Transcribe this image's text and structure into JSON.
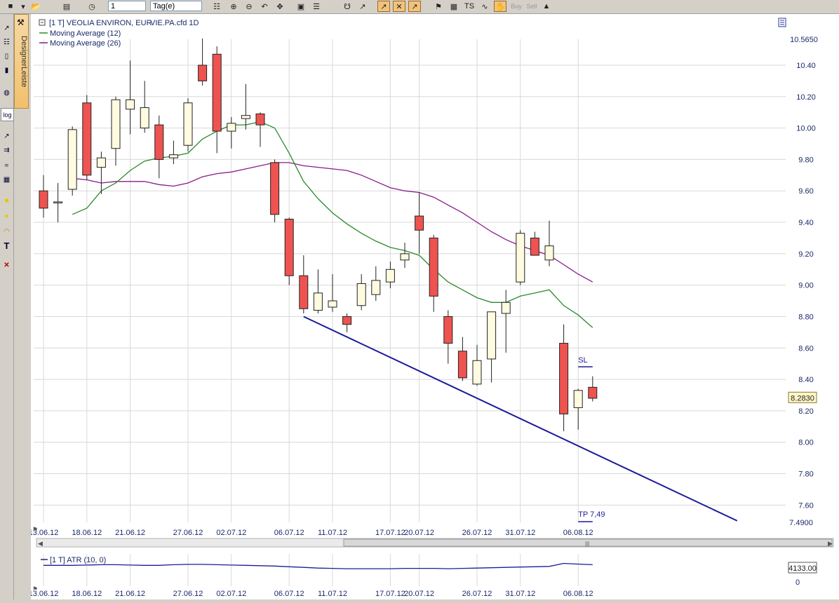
{
  "toolbar": {
    "period_value": "1",
    "timeframe_value": "Tag(e)",
    "buy_label": "Buy",
    "sell_label": "Sell"
  },
  "designer": {
    "label": "DesignerLeiste"
  },
  "left_tools": {
    "log_label": "log",
    "text_tool_label": "T"
  },
  "legend": {
    "instrument": "[1 T] VEOLIA ENVIRON, EUR",
    "symbol": "VIE.PA.cfd 1D",
    "ma12": "Moving Average  (12)",
    "ma26": "Moving Average  (26)"
  },
  "colors": {
    "up_candle": "#fffbe0",
    "down_candle": "#ef5350",
    "ma12": "#2b8a2b",
    "ma26": "#8b1a8b",
    "trendline": "#1c1c99",
    "grid": "#d8d8d8",
    "axis_text": "#1a2a6a"
  },
  "chart_data": [
    {
      "type": "candlestick",
      "ylim": [
        7.49,
        10.565
      ],
      "y_ticks": [
        "10.40",
        "10.20",
        "10.00",
        "9.80",
        "9.60",
        "9.40",
        "9.20",
        "9.00",
        "8.80",
        "8.60",
        "8.40",
        "8.20",
        "8.00",
        "7.80",
        "7.60"
      ],
      "y_top_label": "10.5650",
      "y_bottom_label": "7.4900",
      "x_labels": [
        "13.06.12",
        "18.06.12",
        "21.06.12",
        "27.06.12",
        "02.07.12",
        "06.07.12",
        "11.07.12",
        "17.07.12",
        "20.07.12",
        "26.07.12",
        "31.07.12",
        "06.08.12"
      ],
      "x_label_index": [
        0,
        3,
        6,
        10,
        13,
        17,
        20,
        24,
        26,
        30,
        33,
        37
      ],
      "current_price": "8.2830",
      "candles": [
        {
          "o": 9.6,
          "h": 9.7,
          "l": 9.43,
          "c": 9.49
        },
        {
          "o": 9.53,
          "h": 9.65,
          "l": 9.4,
          "c": 9.53
        },
        {
          "o": 9.61,
          "h": 10.01,
          "l": 9.57,
          "c": 9.99
        },
        {
          "o": 10.16,
          "h": 10.21,
          "l": 9.67,
          "c": 9.7
        },
        {
          "o": 9.75,
          "h": 9.85,
          "l": 9.58,
          "c": 9.81
        },
        {
          "o": 9.87,
          "h": 10.2,
          "l": 9.76,
          "c": 10.18
        },
        {
          "o": 10.12,
          "h": 10.43,
          "l": 9.96,
          "c": 10.18
        },
        {
          "o": 10.0,
          "h": 10.3,
          "l": 9.97,
          "c": 10.13
        },
        {
          "o": 10.02,
          "h": 10.08,
          "l": 9.68,
          "c": 9.8
        },
        {
          "o": 9.81,
          "h": 9.92,
          "l": 9.77,
          "c": 9.83
        },
        {
          "o": 9.89,
          "h": 10.19,
          "l": 9.85,
          "c": 10.16
        },
        {
          "o": 10.4,
          "h": 10.57,
          "l": 10.27,
          "c": 10.3
        },
        {
          "o": 10.47,
          "h": 10.52,
          "l": 9.84,
          "c": 9.98
        },
        {
          "o": 9.98,
          "h": 10.07,
          "l": 9.87,
          "c": 10.03
        },
        {
          "o": 10.06,
          "h": 10.28,
          "l": 9.99,
          "c": 10.08
        },
        {
          "o": 10.09,
          "h": 10.1,
          "l": 9.88,
          "c": 10.02
        },
        {
          "o": 9.78,
          "h": 9.8,
          "l": 9.4,
          "c": 9.45
        },
        {
          "o": 9.42,
          "h": 9.43,
          "l": 9.0,
          "c": 9.06
        },
        {
          "o": 9.06,
          "h": 9.19,
          "l": 8.82,
          "c": 8.85
        },
        {
          "o": 8.84,
          "h": 9.1,
          "l": 8.82,
          "c": 8.95
        },
        {
          "o": 8.86,
          "h": 9.07,
          "l": 8.83,
          "c": 8.9
        },
        {
          "o": 8.8,
          "h": 8.82,
          "l": 8.7,
          "c": 8.75
        },
        {
          "o": 8.87,
          "h": 9.07,
          "l": 8.84,
          "c": 9.01
        },
        {
          "o": 8.94,
          "h": 9.12,
          "l": 8.9,
          "c": 9.03
        },
        {
          "o": 9.02,
          "h": 9.15,
          "l": 8.98,
          "c": 9.1
        },
        {
          "o": 9.16,
          "h": 9.27,
          "l": 9.11,
          "c": 9.2
        },
        {
          "o": 9.44,
          "h": 9.59,
          "l": 9.2,
          "c": 9.35
        },
        {
          "o": 9.3,
          "h": 9.32,
          "l": 8.83,
          "c": 8.93
        },
        {
          "o": 8.8,
          "h": 8.84,
          "l": 8.5,
          "c": 8.63
        },
        {
          "o": 8.58,
          "h": 8.67,
          "l": 8.39,
          "c": 8.41
        },
        {
          "o": 8.37,
          "h": 8.62,
          "l": 8.36,
          "c": 8.52
        },
        {
          "o": 8.53,
          "h": 8.81,
          "l": 8.38,
          "c": 8.83
        },
        {
          "o": 8.82,
          "h": 8.97,
          "l": 8.57,
          "c": 8.89
        },
        {
          "o": 9.02,
          "h": 9.35,
          "l": 9.0,
          "c": 9.33
        },
        {
          "o": 9.3,
          "h": 9.34,
          "l": 9.19,
          "c": 9.19
        },
        {
          "o": 9.16,
          "h": 9.41,
          "l": 9.12,
          "c": 9.25
        },
        {
          "o": 8.63,
          "h": 8.75,
          "l": 8.07,
          "c": 8.18
        },
        {
          "o": 8.22,
          "h": 8.34,
          "l": 8.08,
          "c": 8.33
        },
        {
          "o": 8.35,
          "h": 8.42,
          "l": 8.26,
          "c": 8.28
        }
      ],
      "ma12": [
        [
          2,
          9.45
        ],
        [
          3,
          9.49
        ],
        [
          4,
          9.6
        ],
        [
          5,
          9.65
        ],
        [
          6,
          9.73
        ],
        [
          7,
          9.79
        ],
        [
          8,
          9.81
        ],
        [
          9,
          9.82
        ],
        [
          10,
          9.84
        ],
        [
          11,
          9.93
        ],
        [
          12,
          9.98
        ],
        [
          13,
          10.02
        ],
        [
          14,
          10.02
        ],
        [
          15,
          10.04
        ],
        [
          16,
          10.0
        ],
        [
          17,
          9.84
        ],
        [
          18,
          9.66
        ],
        [
          19,
          9.55
        ],
        [
          20,
          9.46
        ],
        [
          21,
          9.39
        ],
        [
          22,
          9.33
        ],
        [
          23,
          9.28
        ],
        [
          24,
          9.24
        ],
        [
          25,
          9.22
        ],
        [
          26,
          9.19
        ],
        [
          27,
          9.1
        ],
        [
          28,
          9.02
        ],
        [
          29,
          8.97
        ],
        [
          30,
          8.92
        ],
        [
          31,
          8.89
        ],
        [
          32,
          8.89
        ],
        [
          33,
          8.93
        ],
        [
          34,
          8.95
        ],
        [
          35,
          8.97
        ],
        [
          36,
          8.87
        ],
        [
          37,
          8.81
        ],
        [
          38,
          8.73
        ]
      ],
      "ma26": [
        [
          2,
          9.68
        ],
        [
          3,
          9.67
        ],
        [
          4,
          9.65
        ],
        [
          5,
          9.66
        ],
        [
          6,
          9.66
        ],
        [
          7,
          9.66
        ],
        [
          8,
          9.64
        ],
        [
          9,
          9.63
        ],
        [
          10,
          9.65
        ],
        [
          11,
          9.69
        ],
        [
          12,
          9.71
        ],
        [
          13,
          9.72
        ],
        [
          14,
          9.74
        ],
        [
          15,
          9.76
        ],
        [
          16,
          9.78
        ],
        [
          17,
          9.78
        ],
        [
          18,
          9.76
        ],
        [
          19,
          9.75
        ],
        [
          20,
          9.74
        ],
        [
          21,
          9.73
        ],
        [
          22,
          9.7
        ],
        [
          23,
          9.66
        ],
        [
          24,
          9.62
        ],
        [
          25,
          9.6
        ],
        [
          26,
          9.59
        ],
        [
          27,
          9.56
        ],
        [
          28,
          9.51
        ],
        [
          29,
          9.46
        ],
        [
          30,
          9.4
        ],
        [
          31,
          9.34
        ],
        [
          32,
          9.29
        ],
        [
          33,
          9.25
        ],
        [
          34,
          9.22
        ],
        [
          35,
          9.19
        ],
        [
          36,
          9.13
        ],
        [
          37,
          9.07
        ],
        [
          38,
          9.02
        ]
      ],
      "trendline": [
        [
          18,
          8.8
        ],
        [
          48,
          7.5
        ]
      ],
      "sl": {
        "label": "SL",
        "x": [
          37,
          38
        ],
        "y": 8.48
      },
      "tp": {
        "label": "TP 7,49",
        "x": [
          37,
          38
        ],
        "y": 7.49
      }
    },
    {
      "type": "line",
      "legend": "[1 T] ATR  (10, 0)",
      "current_value": "4133.00",
      "y_tick_label": "0",
      "values": [
        0.54,
        0.54,
        0.54,
        0.55,
        0.56,
        0.56,
        0.55,
        0.54,
        0.54,
        0.56,
        0.57,
        0.57,
        0.56,
        0.55,
        0.54,
        0.53,
        0.52,
        0.5,
        0.48,
        0.46,
        0.45,
        0.44,
        0.44,
        0.44,
        0.44,
        0.45,
        0.45,
        0.45,
        0.44,
        0.45,
        0.46,
        0.47,
        0.48,
        0.49,
        0.5,
        0.51,
        0.6,
        0.58,
        0.56
      ],
      "ylim": [
        0,
        0.8
      ]
    }
  ]
}
